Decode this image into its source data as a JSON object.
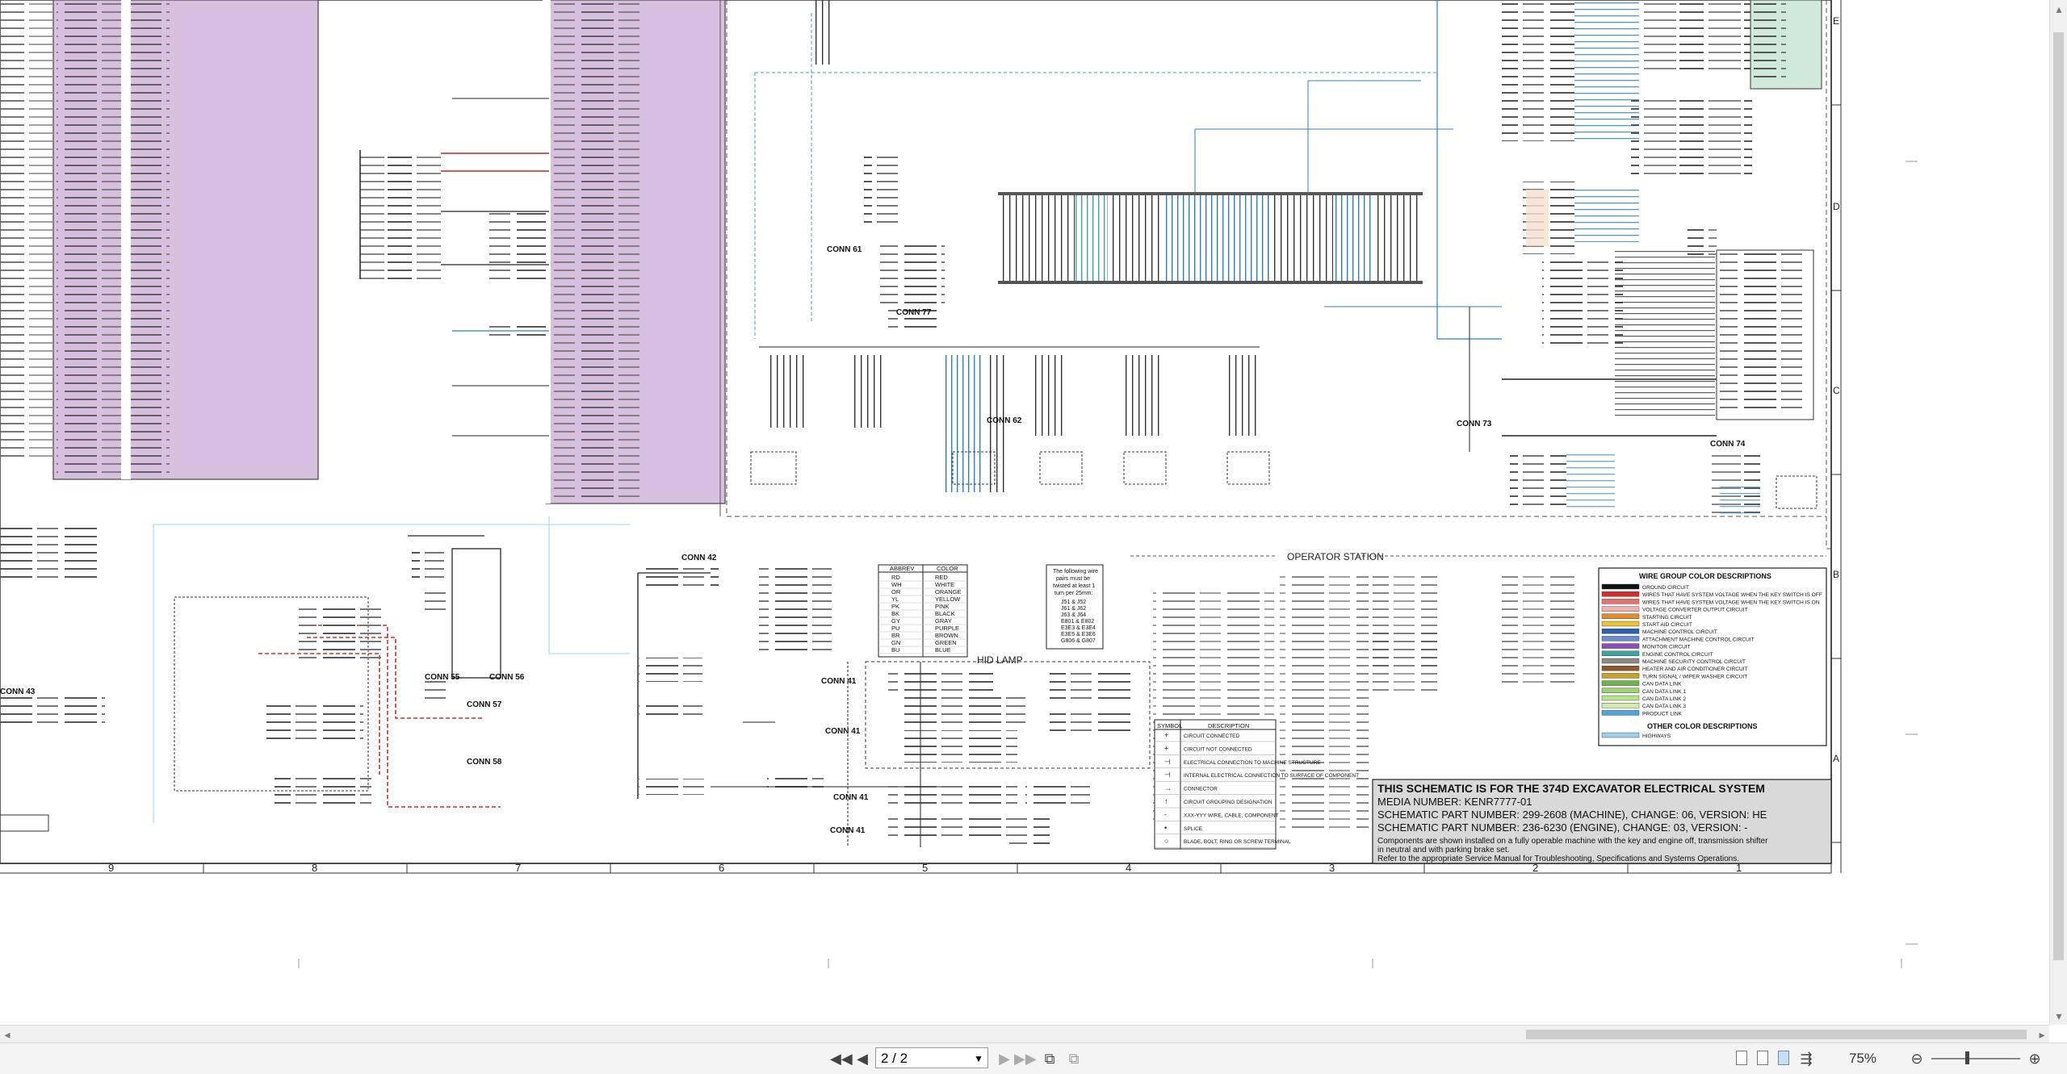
{
  "title_block": {
    "line1": "THIS SCHEMATIC IS FOR THE 374D EXCAVATOR  ELECTRICAL SYSTEM",
    "line2": "MEDIA NUMBER:  KENR7777-01",
    "line3": "SCHEMATIC PART NUMBER: 299-2608 (MACHINE), CHANGE: 06, VERSION: HE",
    "line4": "SCHEMATIC PART NUMBER: 236-6230 (ENGINE), CHANGE: 03, VERSION: -",
    "line5": "Components are shown installed on a fully operable machine with the key and engine off, transmission shifter",
    "line6": "in neutral and with parking brake set.",
    "line7": "Refer to the appropriate Service Manual for Troubleshooting, Specifications and Systems Operations."
  },
  "section_label": "OPERATOR STATION",
  "hid_lamp_label": "HID LAMP",
  "connectors": {
    "conn61": "CONN 61",
    "conn77": "CONN 77",
    "conn62": "CONN 62",
    "conn73": "CONN 73",
    "conn74": "CONN 74",
    "conn42": "CONN 42",
    "conn43": "CONN 43",
    "conn55": "CONN 55",
    "conn56": "CONN 56",
    "conn57": "CONN 57",
    "conn58": "CONN 58",
    "conn41a": "CONN 41",
    "conn41b": "CONN 41",
    "conn41c": "CONN 41",
    "conn41d": "CONN 41"
  },
  "color_abbrev_table": {
    "header_abbrev": "ABBREV",
    "header_color": "COLOR",
    "rows": [
      {
        "abbrev": "RD",
        "color": "RED"
      },
      {
        "abbrev": "WH",
        "color": "WHITE"
      },
      {
        "abbrev": "OR",
        "color": "ORANGE"
      },
      {
        "abbrev": "YL",
        "color": "YELLOW"
      },
      {
        "abbrev": "PK",
        "color": "PINK"
      },
      {
        "abbrev": "BK",
        "color": "BLACK"
      },
      {
        "abbrev": "GY",
        "color": "GRAY"
      },
      {
        "abbrev": "PU",
        "color": "PURPLE"
      },
      {
        "abbrev": "BR",
        "color": "BROWN"
      },
      {
        "abbrev": "GN",
        "color": "GREEN"
      },
      {
        "abbrev": "BU",
        "color": "BLUE"
      }
    ]
  },
  "twist_note": {
    "line1": "The following wire",
    "line2": "pairs must be",
    "line3": "twisted at least 1",
    "line4": "turn per 25mm:",
    "pairs": [
      "J51 & J52",
      "J61 & J62",
      "J63 & J64",
      "E801 & E802",
      "E3E3 & E3E4",
      "E3E5 & E3E6",
      "G806 & G807"
    ]
  },
  "symbol_table": {
    "header_symbol": "SYMBOL",
    "header_desc": "DESCRIPTION",
    "rows": [
      {
        "symbol": "+",
        "desc": "CIRCUIT CONNECTED"
      },
      {
        "symbol": "+",
        "desc": "CIRCUIT NOT CONNECTED"
      },
      {
        "symbol": "⊣",
        "desc": "ELECTRICAL CONNECTION TO MACHINE STRUCTURE"
      },
      {
        "symbol": "⊣",
        "desc": "INTERNAL ELECTRICAL CONNECTION TO SURFACE OF COMPONENT"
      },
      {
        "symbol": "→",
        "desc": "CONNECTOR"
      },
      {
        "symbol": "↑",
        "desc": "CIRCUIT GROUPING DESIGNATION"
      },
      {
        "symbol": "-",
        "desc": "XXX-YYY WIRE, CABLE, COMPONENT"
      },
      {
        "symbol": "•",
        "desc": "SPLICE"
      },
      {
        "symbol": "○",
        "desc": "BLADE, BOLT, RING OR SCREW TERMINAL"
      }
    ]
  },
  "wire_group": {
    "title": "WIRE GROUP COLOR DESCRIPTIONS",
    "rows": [
      {
        "label": "GROUND CIRCUIT",
        "color": "#111111"
      },
      {
        "label": "WIRES THAT HAVE SYSTEM VOLTAGE WHEN THE KEY SWITCH IS OFF",
        "color": "#d92b2b"
      },
      {
        "label": "WIRES THAT HAVE SYSTEM VOLTAGE WHEN THE KEY SWITCH IS ON",
        "color": "#e8706e"
      },
      {
        "label": "VOLTAGE CONVERTER OUTPUT CIRCUIT",
        "color": "#f3b0ad"
      },
      {
        "label": "STARTING CIRCUIT",
        "color": "#e88a2a"
      },
      {
        "label": "START AID CIRCUIT",
        "color": "#e9c23a"
      },
      {
        "label": "MACHINE CONTROL CIRCUIT",
        "color": "#2b5fb2"
      },
      {
        "label": "ATTACHMENT MACHINE CONTROL CIRCUIT",
        "color": "#6b8cd0"
      },
      {
        "label": "MONITOR CIRCUIT",
        "color": "#8a4fb8"
      },
      {
        "label": "ENGINE CONTROL CIRCUIT",
        "color": "#3aa4a0"
      },
      {
        "label": "MACHINE SECURITY CONTROL CIRCUIT",
        "color": "#8a8a8a"
      },
      {
        "label": "HEATER AND AIR CONDITIONER CIRCUIT",
        "color": "#8b5a2b"
      },
      {
        "label": "TURN SIGNAL / WIPER WASHER CIRCUIT",
        "color": "#c9a227"
      },
      {
        "label": "CAN DATA LINK",
        "color": "#6cb44b"
      },
      {
        "label": "CAN DATA LINK 1",
        "color": "#9bd46e"
      },
      {
        "label": "CAN DATA LINK 2",
        "color": "#b8e28c"
      },
      {
        "label": "CAN DATA LINK 3",
        "color": "#d0ecb0"
      },
      {
        "label": "PRODUCT LINK",
        "color": "#4fa7d9"
      }
    ],
    "other_title": "OTHER COLOR DESCRIPTIONS",
    "other_rows": [
      {
        "label": "HIGHWAYS",
        "color": "#9ed0ea"
      }
    ]
  },
  "zone_numbers": [
    "9",
    "8",
    "7",
    "6",
    "5",
    "4",
    "3",
    "2",
    "1"
  ],
  "zone_letters": [
    "E",
    "D",
    "C",
    "B",
    "A"
  ],
  "toolbar": {
    "page_value": "2 / 2",
    "zoom_value": "75%"
  },
  "colors": {
    "monitor_purple": "#d7bfe0",
    "ground": "#111111",
    "power_red": "#d92b2b",
    "control_blue": "#2b5fb2",
    "can_green": "#6cb44b",
    "highway_blue": "#9ed0ea"
  }
}
